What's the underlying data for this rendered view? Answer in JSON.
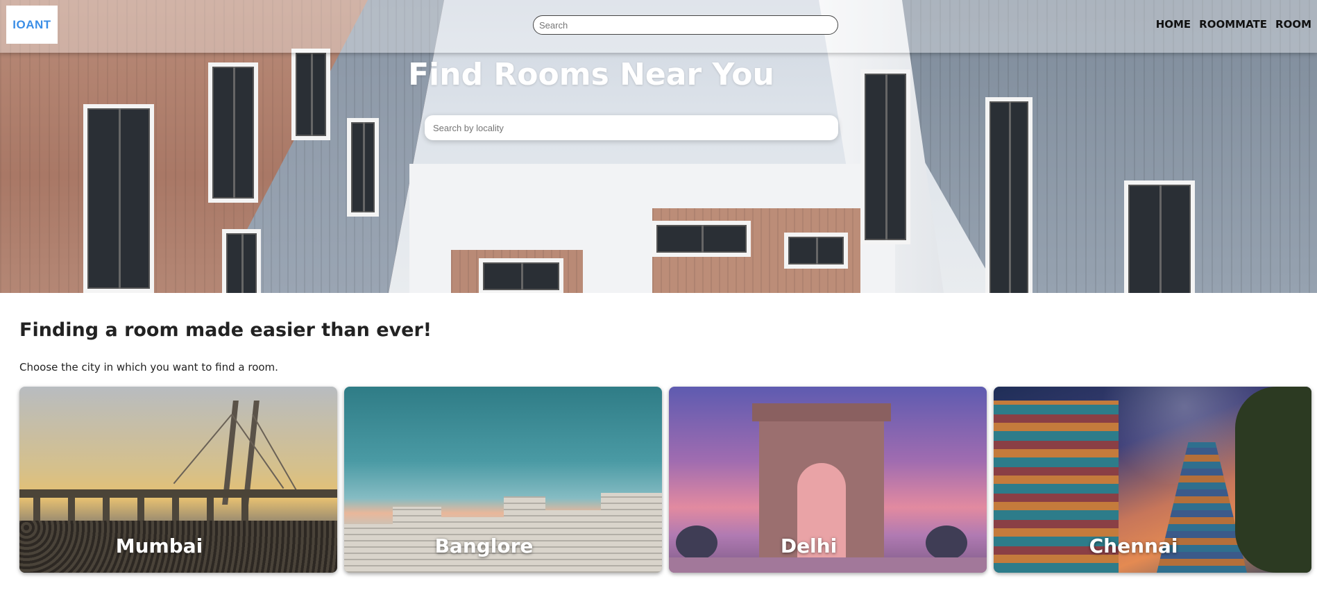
{
  "brand": {
    "logo_text": "IOANT",
    "logo_color": "#3b8ee6"
  },
  "navbar": {
    "search_placeholder": "Search",
    "links": [
      "HOME",
      "ROOMMATE",
      "ROOM"
    ]
  },
  "hero": {
    "title": "Find Rooms Near You",
    "locality_placeholder": "Search by locality"
  },
  "section": {
    "title": "Finding a room made easier than ever!",
    "subtitle": "Choose the city in which you want to find a room."
  },
  "cities": [
    {
      "name": "Mumbai",
      "image": "sea-link-bridge-at-sunset"
    },
    {
      "name": "Banglore",
      "image": "city-skyline-teal-sky"
    },
    {
      "name": "Delhi",
      "image": "india-gate-purple-sky"
    },
    {
      "name": "Chennai",
      "image": "temple-gopuram-night-sky"
    }
  ]
}
